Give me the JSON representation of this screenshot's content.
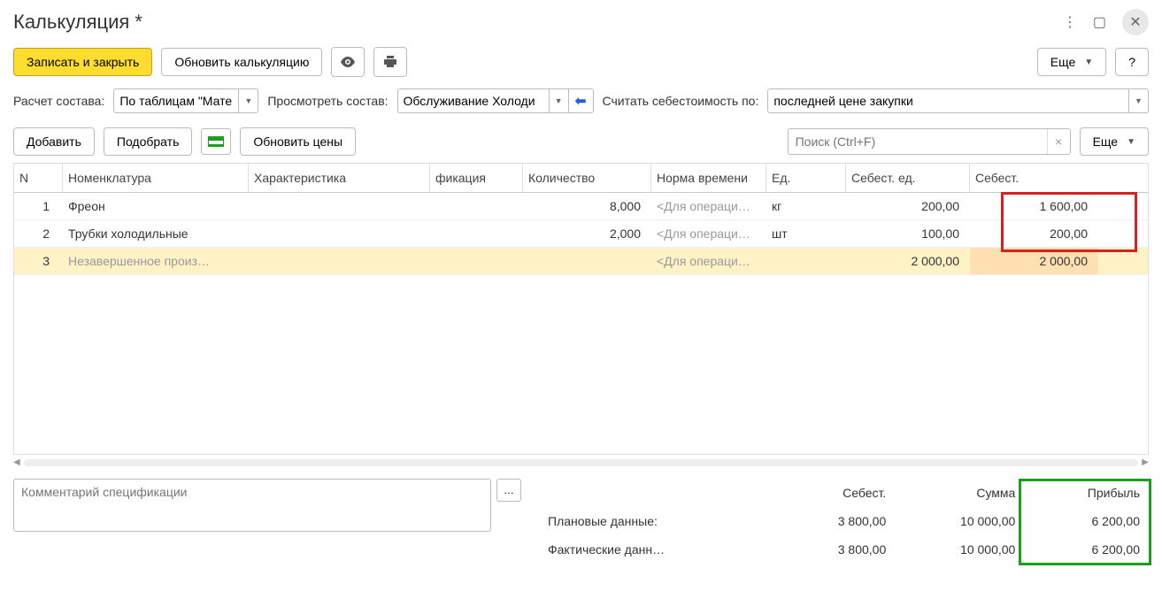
{
  "title": "Калькуляция *",
  "toolbar1": {
    "save_close": "Записать и закрыть",
    "refresh_calc": "Обновить калькуляцию",
    "more": "Еще",
    "help": "?"
  },
  "filters": {
    "compose_label": "Расчет состава:",
    "compose_value": "По таблицам \"Мате",
    "preview_label": "Просмотреть состав:",
    "preview_value": "Обслуживание Холоди",
    "cost_label": "Считать себестоимость по:",
    "cost_value": "последней цене закупки"
  },
  "toolbar2": {
    "add": "Добавить",
    "pick": "Подобрать",
    "refresh_prices": "Обновить цены",
    "search_placeholder": "Поиск (Ctrl+F)",
    "more": "Еще"
  },
  "grid": {
    "headers": {
      "n": "N",
      "nomenclature": "Номенклатура",
      "characteristic": "Характеристика",
      "fication": "фикация",
      "quantity": "Количество",
      "time_norm": "Норма времени",
      "unit": "Ед.",
      "unit_cost": "Себест. ед.",
      "cost": "Себест."
    },
    "rows": [
      {
        "n": "1",
        "nom": "Фреон",
        "char": "",
        "fik": "",
        "qty": "8,000",
        "norm": "<Для операци…",
        "unit": "кг",
        "priceu": "200,00",
        "price": "1 600,00"
      },
      {
        "n": "2",
        "nom": "Трубки холодильные",
        "char": "",
        "fik": "",
        "qty": "2,000",
        "norm": "<Для операци…",
        "unit": "шт",
        "priceu": "100,00",
        "price": "200,00"
      },
      {
        "n": "3",
        "nom": "Незавершенное произ…",
        "char": "",
        "fik": "",
        "qty": "",
        "norm": "<Для операци…",
        "unit": "",
        "priceu": "2 000,00",
        "price": "2 000,00"
      }
    ]
  },
  "comment_placeholder": "Комментарий спецификации",
  "summary": {
    "headers": {
      "cost": "Себест.",
      "sum": "Сумма",
      "profit": "Прибыль"
    },
    "rows": [
      {
        "label": "Плановые данные:",
        "cost": "3 800,00",
        "sum": "10 000,00",
        "profit": "6 200,00"
      },
      {
        "label": "Фактические данн…",
        "cost": "3 800,00",
        "sum": "10 000,00",
        "profit": "6 200,00"
      }
    ]
  }
}
